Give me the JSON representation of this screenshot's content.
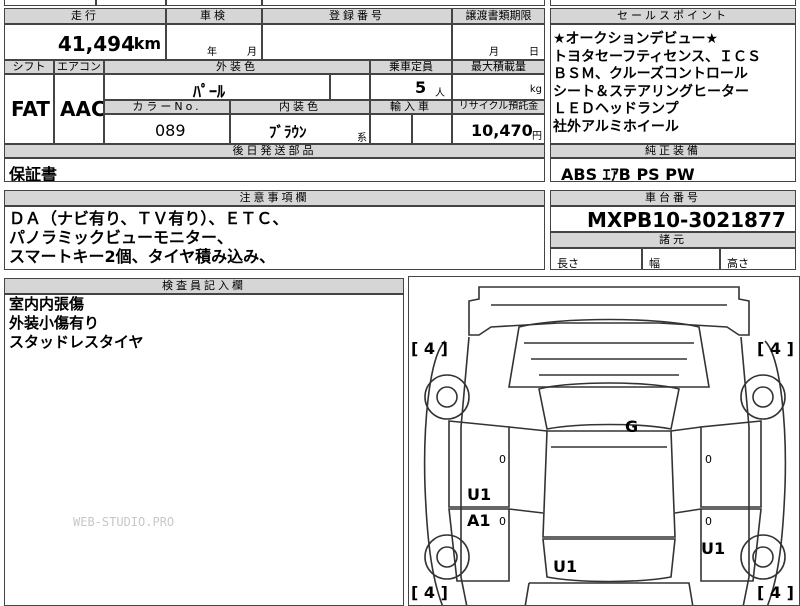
{
  "headers": {
    "mileage": "走行",
    "inspection": "車検",
    "registration_no": "登録番号",
    "transfer_deadline": "譲渡書類期限",
    "sales_points": "セールスポイント",
    "shift": "シフト",
    "aircon": "エアコン",
    "exterior_color": "外装色",
    "capacity": "乗車定員",
    "max_load": "最大積載量",
    "color_no": "カラーNo.",
    "interior_color": "内装色",
    "import": "輸入車",
    "recycle": "リサイクル預託金",
    "later_parts": "後日発送部品",
    "factory_equipment": "純正装備",
    "notes": "注意事項欄",
    "chassis_no": "車台番号",
    "dimensions": "諸元",
    "inspector_notes": "検査員記入欄"
  },
  "units": {
    "km": "km",
    "year": "年",
    "month": "月",
    "day": "日",
    "persons": "人",
    "kg": "kg",
    "yen": "円",
    "series": "系"
  },
  "values": {
    "mileage": "41,494",
    "shift": "FAT",
    "aircon": "AAC",
    "exterior_color": "ﾊﾟｰﾙ",
    "capacity": "5",
    "color_no": "089",
    "interior_color": "ﾌﾞﾗｳﾝ",
    "recycle": "10,470",
    "later_parts": "保証書",
    "factory_equipment": "ABS ｴｱB PS PW",
    "chassis_no": "MXPB10-3021877"
  },
  "sales_points": [
    "★オークションデビュー★",
    "トヨタセーフティセンス、ＩＣＳ",
    "ＢＳＭ、クルーズコントロール",
    "シート＆ステアリングヒーター",
    "ＬＥＤヘッドランプ",
    "社外アルミホイール"
  ],
  "notes": [
    "ＤＡ（ナビ有り、ＴＶ有り）、ＥＴＣ、",
    "パノラミックビューモニター、",
    "スマートキー2個、タイヤ積み込み、"
  ],
  "dimensions": {
    "length": "長さ",
    "width": "幅",
    "height": "高さ"
  },
  "inspector_notes": [
    "室内内張傷",
    "外装小傷有り",
    "スタッドレスタイヤ"
  ],
  "diagram": {
    "tire_fl": "[ 4 ]",
    "tire_fr": "[ 4 ]",
    "tire_rl": "[ 4 ]",
    "tire_rr": "[ 4 ]",
    "roof": "G",
    "left_door_front": "U1",
    "left_door_rear": "A1",
    "rear_quarter_right": "U1",
    "rear_bumper": "U1",
    "small_mark_1": "0",
    "small_mark_2": "0",
    "small_mark_3": "0",
    "small_mark_4": "0"
  },
  "watermark": "WEB-STUDIO.PRO"
}
